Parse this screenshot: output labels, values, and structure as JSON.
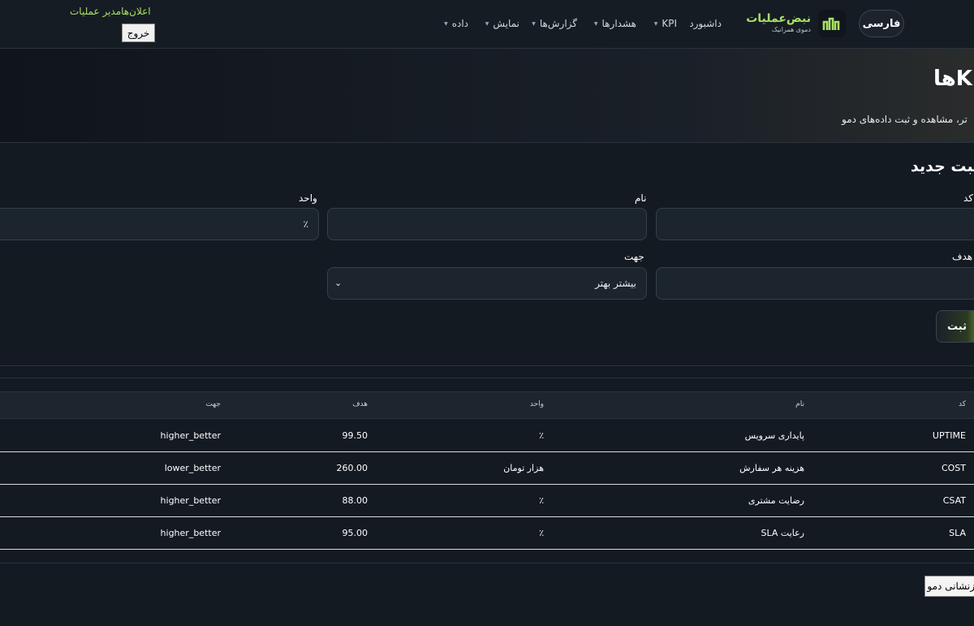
{
  "header": {
    "language_label": "فارسی",
    "brand_name": "نبض‌عملیات",
    "brand_subtitle": "دموی همرانیک",
    "nav": [
      "داشبورد",
      "KPI",
      "هشدارها",
      "گزارش‌ها",
      "نمایش",
      "داده"
    ],
    "announcement": "اعلان‌هامدیر عملیات",
    "logout_label": "خروج"
  },
  "hero": {
    "title": "KPIها",
    "description": "تر، مشاهده و ثبت داده‌های دمو"
  },
  "form": {
    "title": "ثبت جدید",
    "labels": {
      "code": "کد",
      "name": "نام",
      "unit": "واحد",
      "target": "هدف",
      "direction": "جهت"
    },
    "values": {
      "code": "",
      "name": "",
      "unit": "٪",
      "target": "",
      "direction": "بیشتر بهتر"
    },
    "submit_label": "ثبت"
  },
  "table": {
    "headers": [
      "کد",
      "نام",
      "واحد",
      "هدف",
      "جهت"
    ],
    "rows": [
      [
        "UPTIME",
        "پایداری سرویس",
        "٪",
        "99.50",
        "higher_better"
      ],
      [
        "COST",
        "هزینه هر سفارش",
        "هزار تومان",
        "260.00",
        "lower_better"
      ],
      [
        "CSAT",
        "رضایت مشتری",
        "٪",
        "88.00",
        "higher_better"
      ],
      [
        "SLA",
        "رعایت SLA",
        "٪",
        "95.00",
        "higher_better"
      ]
    ]
  },
  "footer": {
    "demo_reset_label": "بازنشانی دمو"
  },
  "colors": {
    "accent": "#a8e063",
    "background": "#141a22"
  }
}
